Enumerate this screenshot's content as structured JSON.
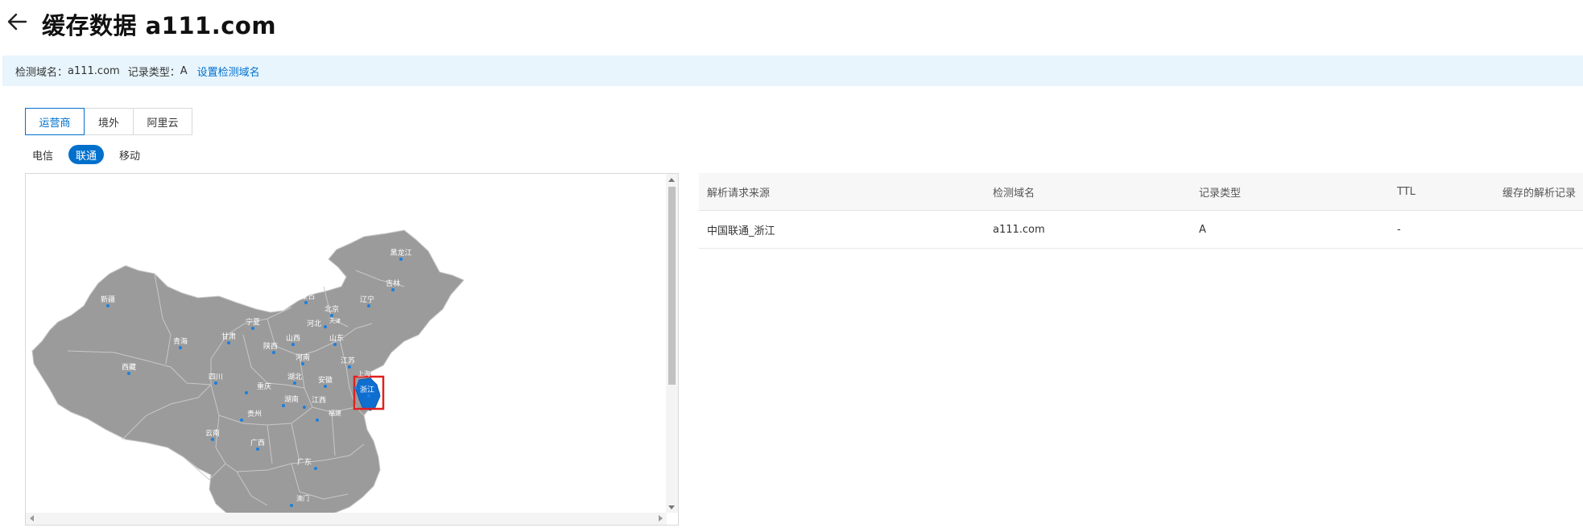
{
  "header": {
    "title": "缓存数据 a111.com"
  },
  "info_bar": {
    "domain_label": "检测域名：",
    "domain_value": "a111.com",
    "record_label": "记录类型：",
    "record_value": "A",
    "settings_link": "设置检测域名"
  },
  "tabs": [
    {
      "label": "运营商",
      "active": true
    },
    {
      "label": "境外",
      "active": false
    },
    {
      "label": "阿里云",
      "active": false
    }
  ],
  "subtabs": [
    {
      "label": "电信",
      "active": false
    },
    {
      "label": "联通",
      "active": true
    },
    {
      "label": "移动",
      "active": false
    }
  ],
  "map": {
    "highlight_color": "#0f6fd1",
    "region_color": "#9b9b9b",
    "marker_color": "#1a7fe0",
    "selected_region": "浙江",
    "provinces": [
      "黑龙江",
      "吉林",
      "辽宁",
      "内蒙古",
      "北京",
      "河北",
      "天津",
      "新疆",
      "宁夏",
      "青海",
      "甘肃",
      "山西",
      "陕西",
      "山东",
      "河南",
      "西藏",
      "四川",
      "湖北",
      "安徽",
      "江苏",
      "上海",
      "重庆",
      "浙江",
      "湖南",
      "江西",
      "贵州",
      "福建",
      "云南",
      "广西",
      "广东",
      "澳门"
    ]
  },
  "table": {
    "columns": [
      "解析请求来源",
      "检测域名",
      "记录类型",
      "TTL",
      "缓存的解析记录"
    ],
    "rows": [
      {
        "source": "中国联通_浙江",
        "domain": "a111.com",
        "type": "A",
        "ttl": "-",
        "record": ""
      }
    ]
  }
}
